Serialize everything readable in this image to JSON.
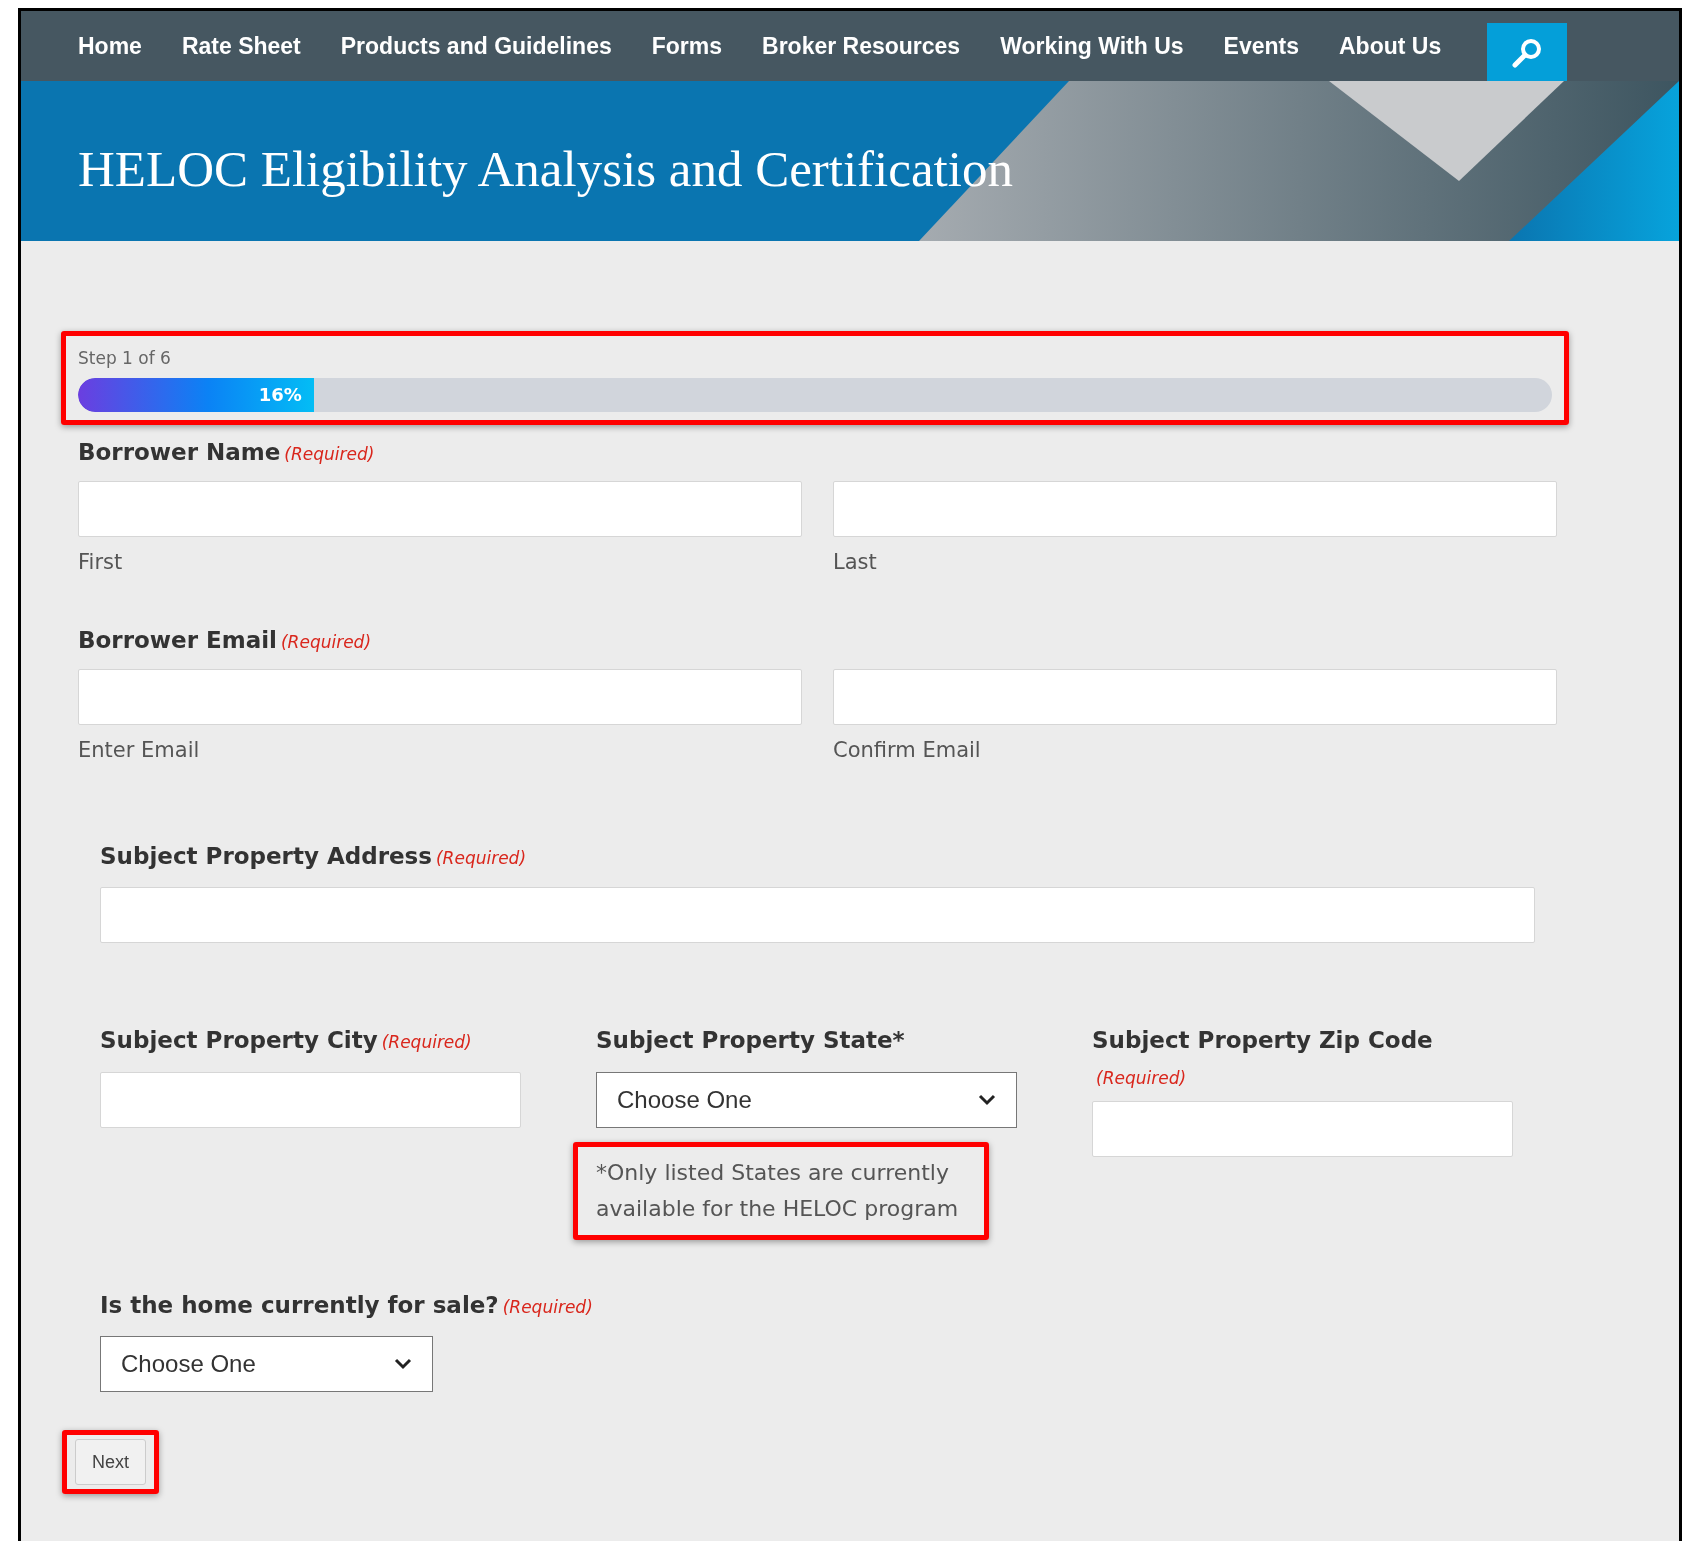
{
  "nav": {
    "items": [
      {
        "label": "Home"
      },
      {
        "label": "Rate Sheet"
      },
      {
        "label": "Products and Guidelines"
      },
      {
        "label": "Forms"
      },
      {
        "label": "Broker Resources"
      },
      {
        "label": "Working With Us"
      },
      {
        "label": "Events"
      },
      {
        "label": "About Us"
      }
    ]
  },
  "banner": {
    "title": "HELOC Eligibility Analysis and Certification"
  },
  "progress": {
    "step": "Step 1 of 6",
    "level": 0.16,
    "reading": "16%",
    "highlighted": true
  },
  "borrower_name": {
    "label": "Borrower Name",
    "required": "(Required)",
    "fields": [
      {
        "sublabel": "First"
      },
      {
        "sublabel": "Last"
      }
    ]
  },
  "borrower_email": {
    "label": "Borrower Email",
    "required": "(Required)",
    "fields": [
      {
        "sublabel": "Enter Email"
      },
      {
        "sublabel": "Confirm Email"
      }
    ]
  },
  "address": {
    "label": "Subject Property Address",
    "required": "(Required)"
  },
  "city": {
    "label": "Subject Property City",
    "required": "(Required)"
  },
  "state": {
    "label": "Subject Property State*",
    "value": "Choose One",
    "note": "*Only listed States are currently available for the HELOC program",
    "note_highlighted": true
  },
  "zip": {
    "label": "Subject Property Zip Code",
    "required": "(Required)"
  },
  "for_sale": {
    "label": "Is the home currently for sale?",
    "required": "(Required)",
    "value": "Choose One"
  },
  "next_button": {
    "label": "Next",
    "highlighted": true
  }
}
